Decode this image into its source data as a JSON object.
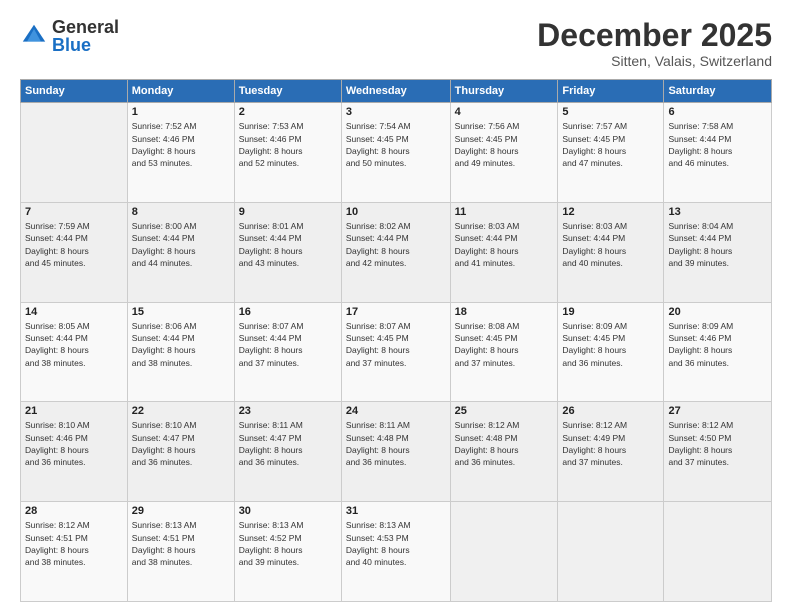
{
  "logo": {
    "general": "General",
    "blue": "Blue"
  },
  "header": {
    "month": "December 2025",
    "location": "Sitten, Valais, Switzerland"
  },
  "weekdays": [
    "Sunday",
    "Monday",
    "Tuesday",
    "Wednesday",
    "Thursday",
    "Friday",
    "Saturday"
  ],
  "weeks": [
    [
      {
        "day": "",
        "info": ""
      },
      {
        "day": "1",
        "info": "Sunrise: 7:52 AM\nSunset: 4:46 PM\nDaylight: 8 hours\nand 53 minutes."
      },
      {
        "day": "2",
        "info": "Sunrise: 7:53 AM\nSunset: 4:46 PM\nDaylight: 8 hours\nand 52 minutes."
      },
      {
        "day": "3",
        "info": "Sunrise: 7:54 AM\nSunset: 4:45 PM\nDaylight: 8 hours\nand 50 minutes."
      },
      {
        "day": "4",
        "info": "Sunrise: 7:56 AM\nSunset: 4:45 PM\nDaylight: 8 hours\nand 49 minutes."
      },
      {
        "day": "5",
        "info": "Sunrise: 7:57 AM\nSunset: 4:45 PM\nDaylight: 8 hours\nand 47 minutes."
      },
      {
        "day": "6",
        "info": "Sunrise: 7:58 AM\nSunset: 4:44 PM\nDaylight: 8 hours\nand 46 minutes."
      }
    ],
    [
      {
        "day": "7",
        "info": "Sunrise: 7:59 AM\nSunset: 4:44 PM\nDaylight: 8 hours\nand 45 minutes."
      },
      {
        "day": "8",
        "info": "Sunrise: 8:00 AM\nSunset: 4:44 PM\nDaylight: 8 hours\nand 44 minutes."
      },
      {
        "day": "9",
        "info": "Sunrise: 8:01 AM\nSunset: 4:44 PM\nDaylight: 8 hours\nand 43 minutes."
      },
      {
        "day": "10",
        "info": "Sunrise: 8:02 AM\nSunset: 4:44 PM\nDaylight: 8 hours\nand 42 minutes."
      },
      {
        "day": "11",
        "info": "Sunrise: 8:03 AM\nSunset: 4:44 PM\nDaylight: 8 hours\nand 41 minutes."
      },
      {
        "day": "12",
        "info": "Sunrise: 8:03 AM\nSunset: 4:44 PM\nDaylight: 8 hours\nand 40 minutes."
      },
      {
        "day": "13",
        "info": "Sunrise: 8:04 AM\nSunset: 4:44 PM\nDaylight: 8 hours\nand 39 minutes."
      }
    ],
    [
      {
        "day": "14",
        "info": "Sunrise: 8:05 AM\nSunset: 4:44 PM\nDaylight: 8 hours\nand 38 minutes."
      },
      {
        "day": "15",
        "info": "Sunrise: 8:06 AM\nSunset: 4:44 PM\nDaylight: 8 hours\nand 38 minutes."
      },
      {
        "day": "16",
        "info": "Sunrise: 8:07 AM\nSunset: 4:44 PM\nDaylight: 8 hours\nand 37 minutes."
      },
      {
        "day": "17",
        "info": "Sunrise: 8:07 AM\nSunset: 4:45 PM\nDaylight: 8 hours\nand 37 minutes."
      },
      {
        "day": "18",
        "info": "Sunrise: 8:08 AM\nSunset: 4:45 PM\nDaylight: 8 hours\nand 37 minutes."
      },
      {
        "day": "19",
        "info": "Sunrise: 8:09 AM\nSunset: 4:45 PM\nDaylight: 8 hours\nand 36 minutes."
      },
      {
        "day": "20",
        "info": "Sunrise: 8:09 AM\nSunset: 4:46 PM\nDaylight: 8 hours\nand 36 minutes."
      }
    ],
    [
      {
        "day": "21",
        "info": "Sunrise: 8:10 AM\nSunset: 4:46 PM\nDaylight: 8 hours\nand 36 minutes."
      },
      {
        "day": "22",
        "info": "Sunrise: 8:10 AM\nSunset: 4:47 PM\nDaylight: 8 hours\nand 36 minutes."
      },
      {
        "day": "23",
        "info": "Sunrise: 8:11 AM\nSunset: 4:47 PM\nDaylight: 8 hours\nand 36 minutes."
      },
      {
        "day": "24",
        "info": "Sunrise: 8:11 AM\nSunset: 4:48 PM\nDaylight: 8 hours\nand 36 minutes."
      },
      {
        "day": "25",
        "info": "Sunrise: 8:12 AM\nSunset: 4:48 PM\nDaylight: 8 hours\nand 36 minutes."
      },
      {
        "day": "26",
        "info": "Sunrise: 8:12 AM\nSunset: 4:49 PM\nDaylight: 8 hours\nand 37 minutes."
      },
      {
        "day": "27",
        "info": "Sunrise: 8:12 AM\nSunset: 4:50 PM\nDaylight: 8 hours\nand 37 minutes."
      }
    ],
    [
      {
        "day": "28",
        "info": "Sunrise: 8:12 AM\nSunset: 4:51 PM\nDaylight: 8 hours\nand 38 minutes."
      },
      {
        "day": "29",
        "info": "Sunrise: 8:13 AM\nSunset: 4:51 PM\nDaylight: 8 hours\nand 38 minutes."
      },
      {
        "day": "30",
        "info": "Sunrise: 8:13 AM\nSunset: 4:52 PM\nDaylight: 8 hours\nand 39 minutes."
      },
      {
        "day": "31",
        "info": "Sunrise: 8:13 AM\nSunset: 4:53 PM\nDaylight: 8 hours\nand 40 minutes."
      },
      {
        "day": "",
        "info": ""
      },
      {
        "day": "",
        "info": ""
      },
      {
        "day": "",
        "info": ""
      }
    ]
  ]
}
